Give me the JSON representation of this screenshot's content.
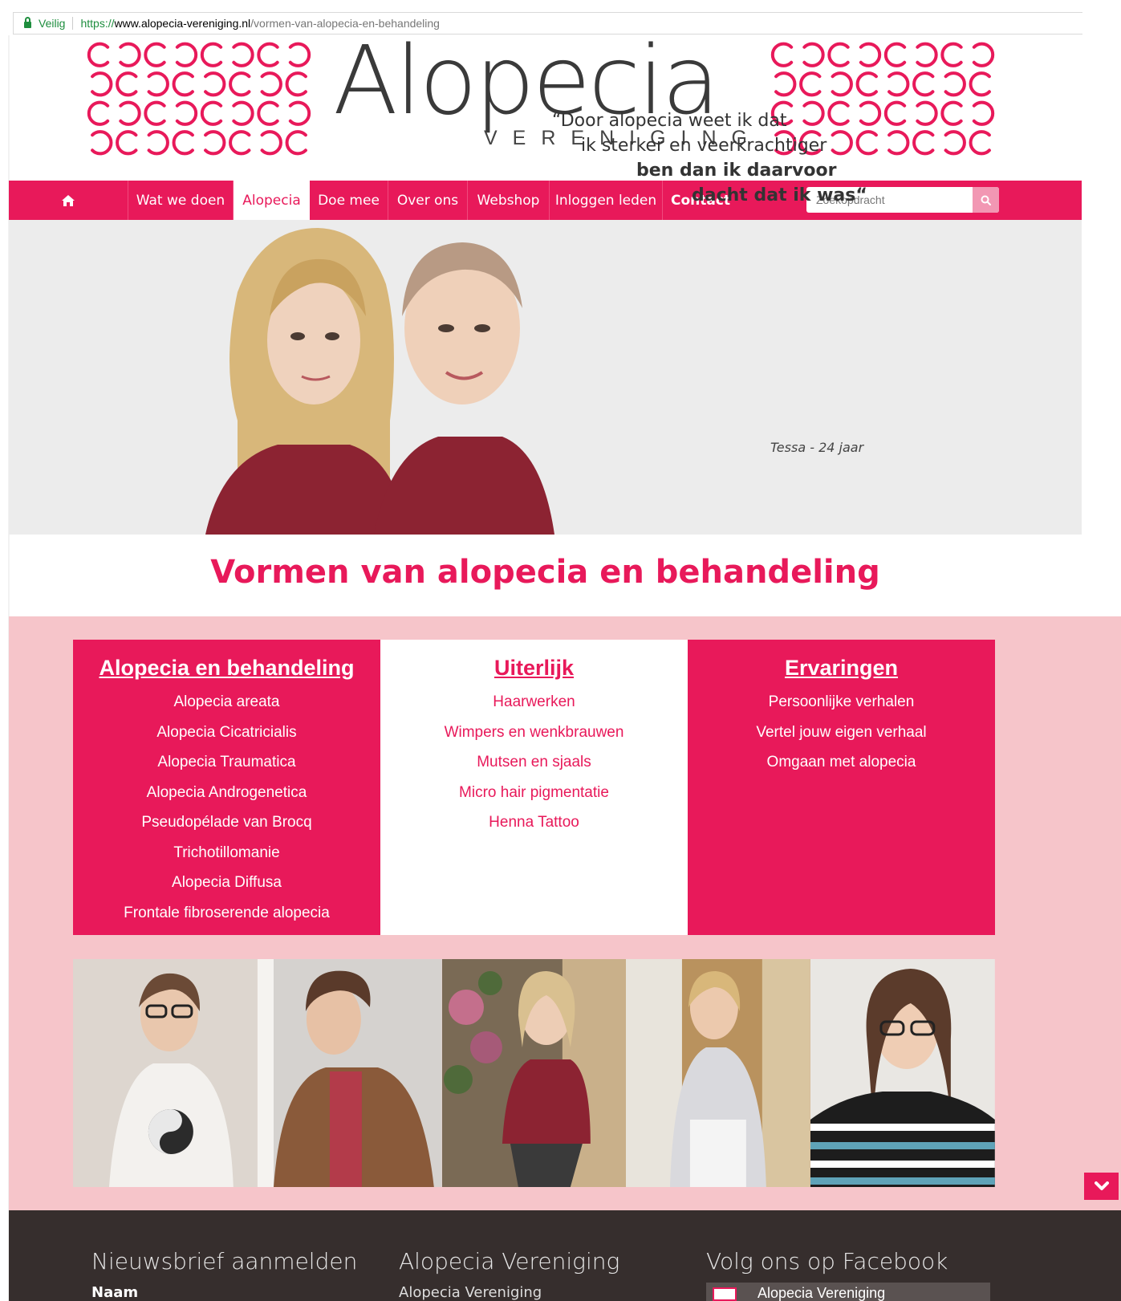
{
  "browser": {
    "secure_label": "Veilig",
    "url_scheme": "https://",
    "url_host": "www.alopecia-vereniging.nl",
    "url_path": "/vormen-van-alopecia-en-behandeling"
  },
  "header": {
    "logo_word": "Alopecia",
    "logo_sub": "VERENIGING",
    "accent_color": "#e8195a"
  },
  "nav": {
    "home_icon": "home-icon",
    "items": [
      {
        "label": "Wat we doen"
      },
      {
        "label": "Alopecia"
      },
      {
        "label": "Doe mee"
      },
      {
        "label": "Over ons"
      },
      {
        "label": "Webshop"
      },
      {
        "label": "Inloggen leden"
      },
      {
        "label": "Contact"
      }
    ],
    "search_placeholder": "Zoekopdracht",
    "search_icon": "search-icon"
  },
  "hero": {
    "quote_lines": [
      "“Door alopecia weet ik dat",
      "ik sterker en veerkrachtiger",
      "ben dan ik daarvoor",
      "dacht dat ik was“"
    ],
    "author": "Tessa - 24 jaar"
  },
  "page_title": "Vormen van alopecia en behandeling",
  "columns": [
    {
      "heading": "Alopecia en behandeling",
      "links": [
        "Alopecia areata",
        "Alopecia Cicatricialis",
        "Alopecia Traumatica",
        "Alopecia Androgenetica",
        "Pseudopélade van Brocq",
        "Trichotillomanie",
        "Alopecia Diffusa",
        "Frontale fibroserende alopecia"
      ]
    },
    {
      "heading": "Uiterlijk",
      "links": [
        "Haarwerken",
        "Wimpers en wenkbrauwen",
        "Mutsen en sjaals",
        "Micro hair pigmentatie",
        "Henna Tattoo"
      ]
    },
    {
      "heading": "Ervaringen",
      "links": [
        "Persoonlijke verhalen",
        "Vertel jouw eigen verhaal",
        "Omgaan met alopecia"
      ]
    }
  ],
  "scroll_icon": "chevron-down-icon",
  "footer": {
    "newsletter_title": "Nieuwsbrief aanmelden",
    "newsletter_field": "Naam",
    "org_title": "Alopecia Vereniging",
    "org_line": "Alopecia Vereniging",
    "facebook_title": "Volg ons op Facebook",
    "facebook_page_name": "Alopecia Vereniging"
  }
}
